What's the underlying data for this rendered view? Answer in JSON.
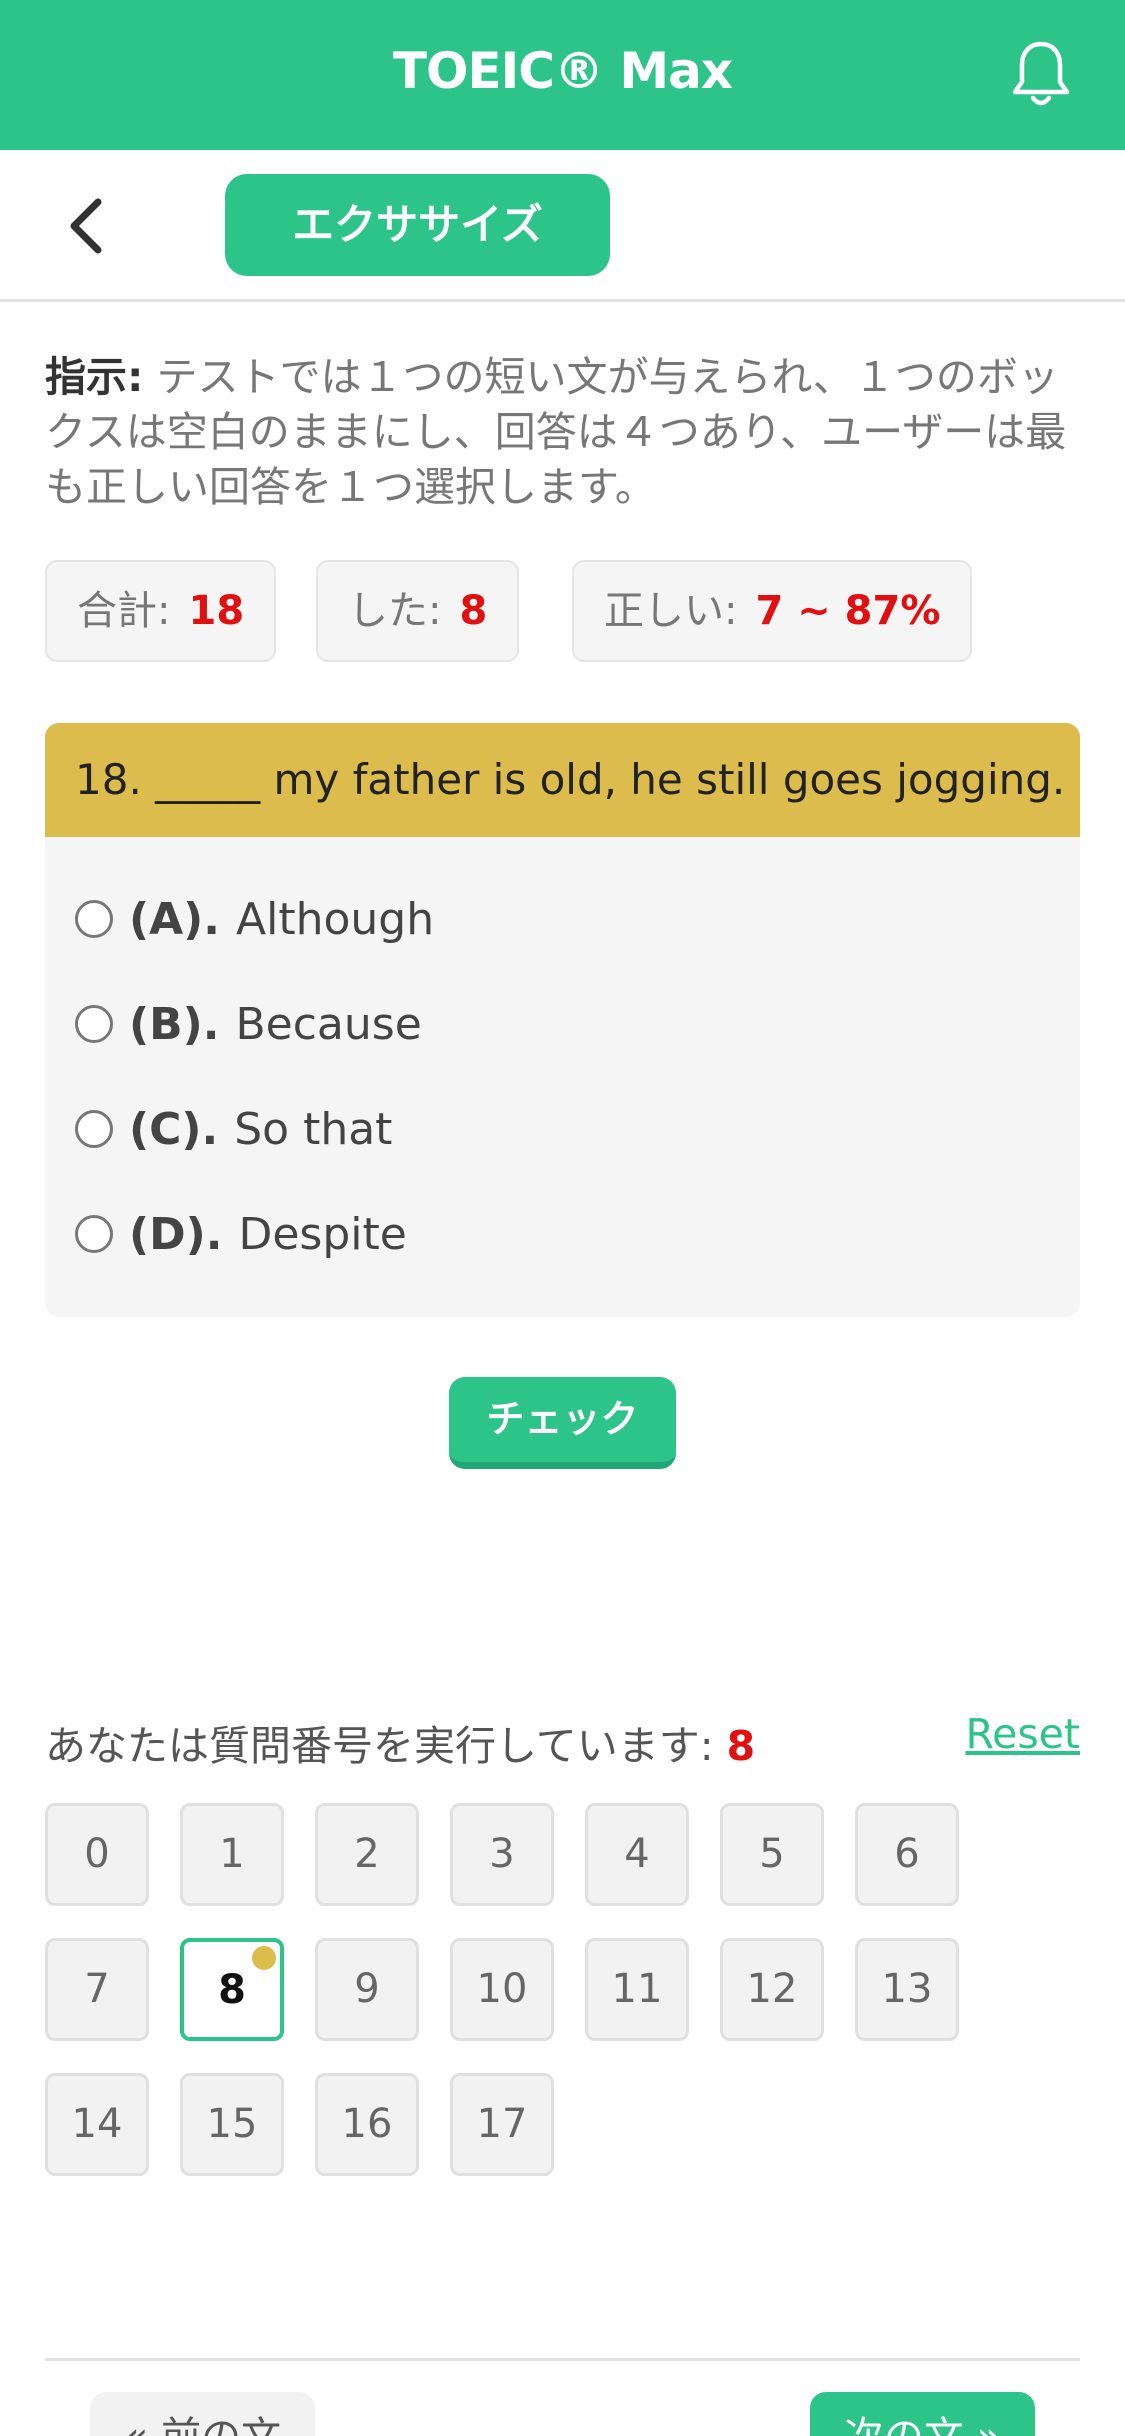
{
  "app": {
    "title": "TOEIC® Max"
  },
  "nav": {
    "tab_label": "エクササイズ"
  },
  "instructions": {
    "label": "指示:",
    "text": " テストでは１つの短い文が与えられ、１つのボックスは空白のままにし、回答は４つあり、ユーザーは最も正しい回答を１つ選択します。"
  },
  "stats": {
    "total_label": "合計:",
    "total_value": "18",
    "done_label": "した:",
    "done_value": "8",
    "correct_label": "正しい:",
    "correct_value": "7 ~ 87%"
  },
  "question": {
    "text": "18. _____ my father is old, he still goes jogging.",
    "options": [
      {
        "letter": "(A).",
        "text": "Although"
      },
      {
        "letter": "(B).",
        "text": "Because"
      },
      {
        "letter": "(C).",
        "text": "So that"
      },
      {
        "letter": "(D).",
        "text": "Despite"
      }
    ]
  },
  "check_label": "チェック",
  "progress": {
    "label": "あなたは質問番号を実行しています:",
    "current": "8",
    "reset_label": "Reset",
    "numbers": [
      "0",
      "1",
      "2",
      "3",
      "4",
      "5",
      "6",
      "7",
      "8",
      "9",
      "10",
      "11",
      "12",
      "13",
      "14",
      "15",
      "16",
      "17"
    ]
  },
  "footer": {
    "prev_label": "« 前の文",
    "next_label": "次の文 »"
  },
  "colors": {
    "accent": "#2dc48a",
    "question_header": "#dcbc4c",
    "highlight": "#e01010"
  },
  "icons": {
    "bell": "bell-icon",
    "back": "back-chevron-icon"
  }
}
